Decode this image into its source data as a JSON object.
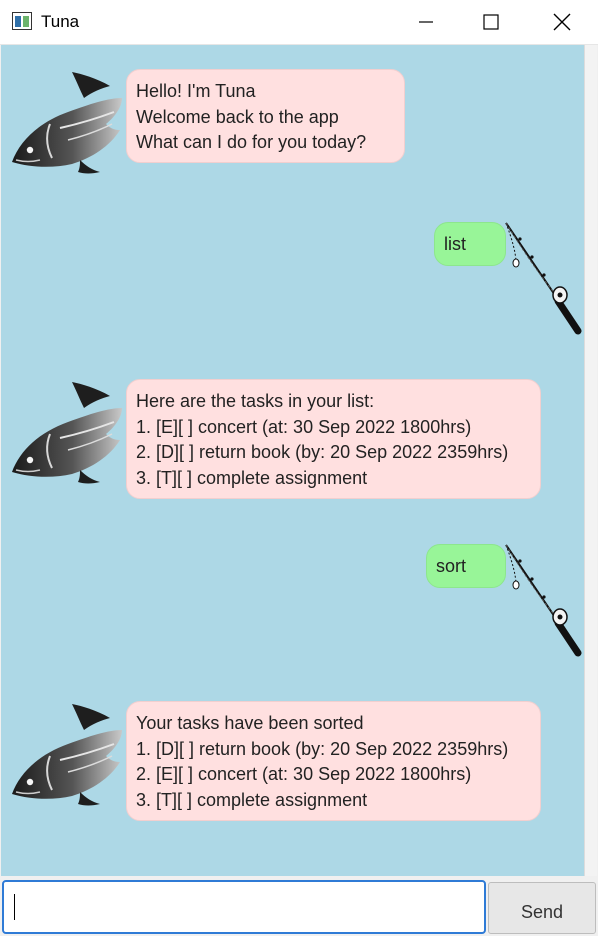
{
  "window": {
    "title": "Tuna"
  },
  "messages": [
    {
      "sender": "bot",
      "lines": [
        "Hello! I'm Tuna",
        "Welcome back to the app",
        "What can I do for you today?"
      ]
    },
    {
      "sender": "user",
      "lines": [
        "list"
      ]
    },
    {
      "sender": "bot",
      "lines": [
        "Here are the tasks in your list:",
        "1. [E][ ] concert (at: 30 Sep 2022 1800hrs)",
        "2. [D][ ] return book (by: 20 Sep 2022 2359hrs)",
        "3. [T][ ] complete assignment"
      ]
    },
    {
      "sender": "user",
      "lines": [
        "sort"
      ]
    },
    {
      "sender": "bot",
      "lines": [
        "Your tasks have been sorted",
        "1. [D][ ] return book (by: 20 Sep 2022 2359hrs)",
        "2. [E][ ] concert (at: 30 Sep 2022 1800hrs)",
        "3. [T][ ] complete assignment"
      ]
    }
  ],
  "input": {
    "value": "",
    "send_label": "Send"
  },
  "icons": {
    "bot_avatar": "tuna-fish-icon",
    "user_avatar": "fishing-rod-icon",
    "app": "window-app-icon"
  },
  "colors": {
    "chat_background": "#add8e6",
    "bot_bubble": "#ffe0e0",
    "user_bubble": "#98f598"
  }
}
